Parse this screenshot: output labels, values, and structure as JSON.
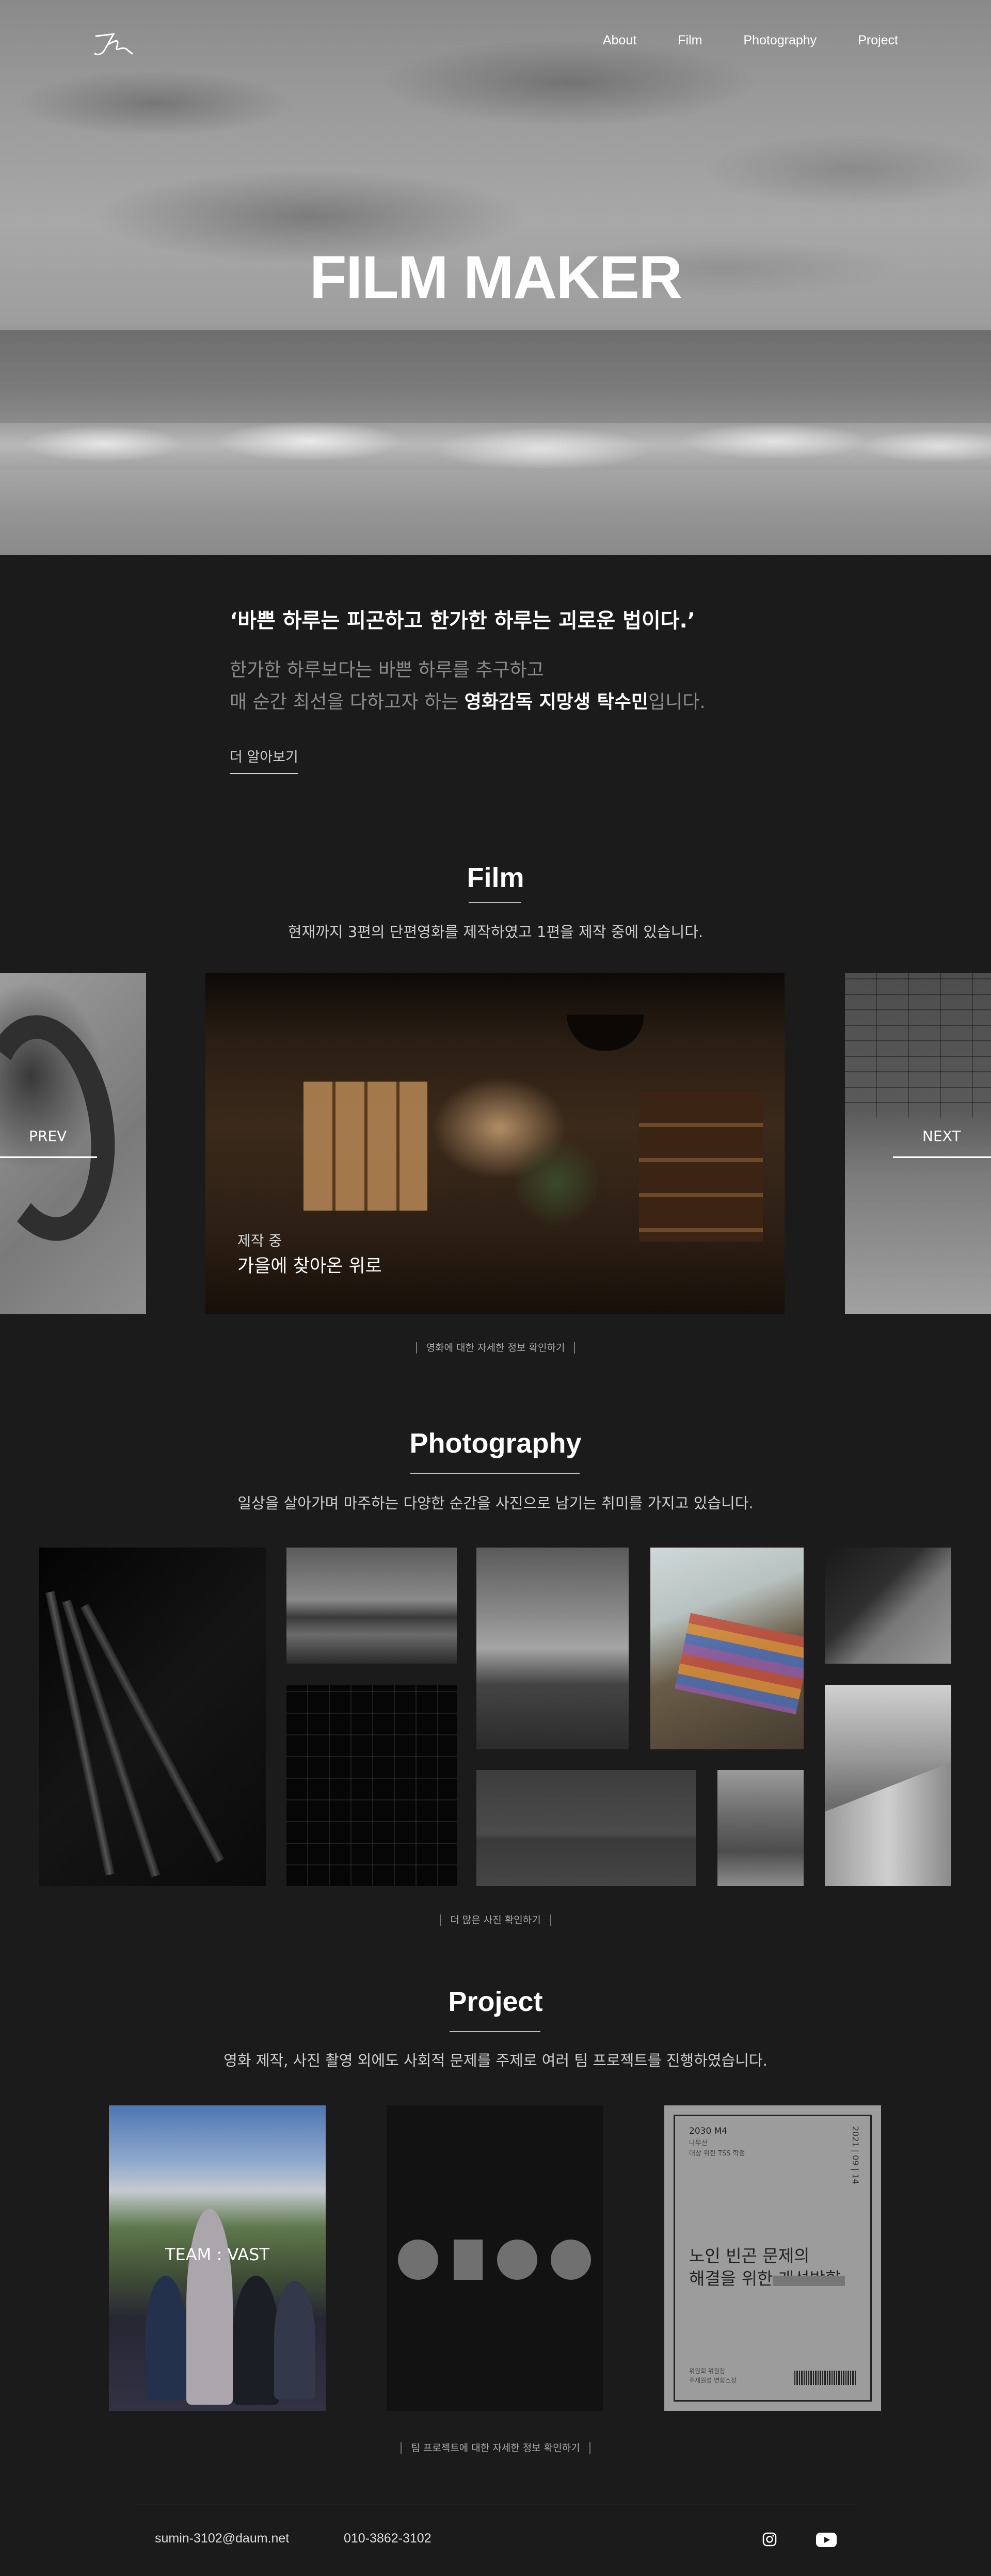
{
  "nav": {
    "logo_icon": "signature-logo-icon",
    "items": [
      "About",
      "Film",
      "Photography",
      "Project"
    ]
  },
  "hero": {
    "title": "FILM MAKER"
  },
  "intro": {
    "quote": "‘바쁜 하루는 피곤하고 한가한 하루는 괴로운 법이다.’",
    "line1": "한가한 하루보다는 바쁜 하루를 추구하고",
    "line2_pre": "매 순간 최선을 다하고자 하는 ",
    "line2_em": "영화감독 지망생 탁수민",
    "line2_post": "입니다.",
    "more": "더 알아보기"
  },
  "film": {
    "title": "Film",
    "subtitle": "현재까지 3편의 단편영화를 제작하였고 1편을 제작 중에 있습니다.",
    "prev": "PREV",
    "next": "NEXT",
    "status": "제작 중",
    "name": "가을에 찾아온 위로",
    "link": "영화에 대한 자세한 정보 확인하기"
  },
  "photography": {
    "title": "Photography",
    "subtitle": "일상을 살아가며 마주하는 다양한 순간을 사진으로 남기는 취미를 가지고 있습니다.",
    "link": "더 많은 사진 확인하기"
  },
  "project": {
    "title": "Project",
    "subtitle": "영화 제작, 사진 촬영 외에도 사회적 문제를 주제로 여러 팀 프로젝트를 진행하였습니다.",
    "team_label": "TEAM : VAST",
    "book": {
      "code": "2030 M4",
      "meta": "나무산\n대상 위한 TSS 학점",
      "vertical": "2021 | 09 | 14",
      "headline_1": "노인 빈곤 문제의",
      "headline_2": "해결을 위한 개선방향",
      "footer": "위원회 위원장\n주재원성 연합소장"
    },
    "link": "팀 프로젝트에 대한 자세한 정보 확인하기"
  },
  "footer": {
    "email": "sumin-3102@daum.net",
    "phone": "010-3862-3102",
    "icons": [
      "instagram-icon",
      "youtube-icon"
    ]
  }
}
